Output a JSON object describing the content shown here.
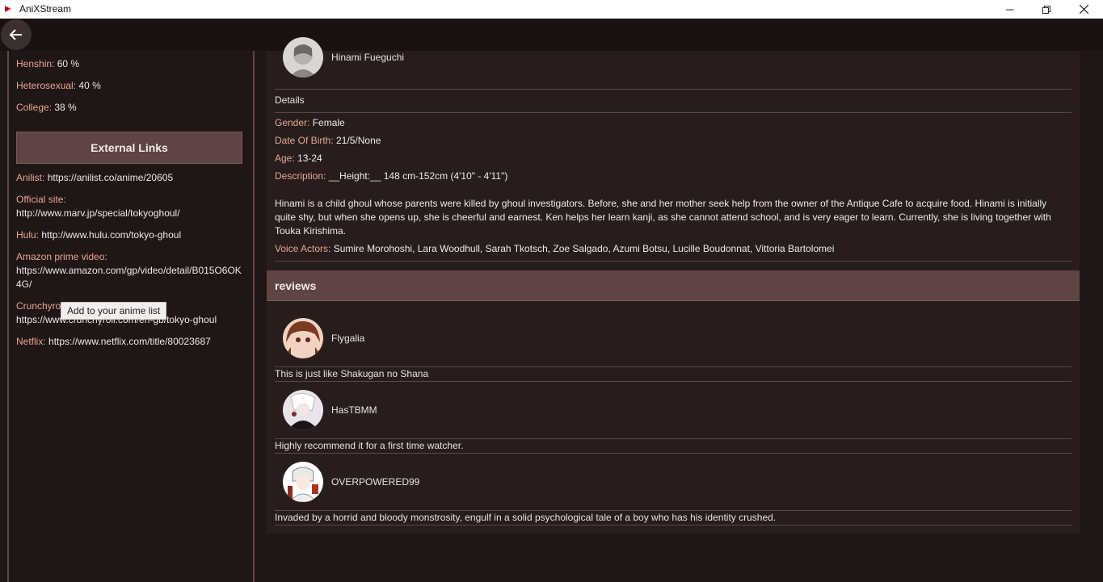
{
  "window": {
    "title": "AniXStream"
  },
  "sidebar": {
    "tags": [
      {
        "label": "Henshin:",
        "value": "60 %"
      },
      {
        "label": "Heterosexual:",
        "value": "40 %"
      },
      {
        "label": "College:",
        "value": "38 %"
      }
    ],
    "external_links_title": "External Links",
    "links": [
      {
        "label": "Anilist:",
        "url": "https://anilist.co/anime/20605"
      },
      {
        "label": "Official site:",
        "url": "http://www.marv.jp/special/tokyoghoul/"
      },
      {
        "label": "Hulu:",
        "url": "http://www.hulu.com/tokyo-ghoul"
      },
      {
        "label": "Amazon prime video:",
        "url": "https://www.amazon.com/gp/video/detail/B015O6OK4G/"
      },
      {
        "label": "Crunchyroll:",
        "url": "https://www.crunchyroll.com/en-gb/tokyo-ghoul"
      },
      {
        "label": "Netflix:",
        "url": "https://www.netflix.com/title/80023687"
      }
    ],
    "tooltip": "Add to your anime list"
  },
  "character": {
    "name": "Hinami Fueguchi",
    "details_title": "Details",
    "gender_label": "Gender:",
    "gender": "Female",
    "dob_label": "Date Of Birth:",
    "dob": "21/5/None",
    "age_label": "Age:",
    "age": "13-24",
    "description_label": "Description:",
    "description_short": "__Height:__ 148 cm-152cm (4'10\" - 4'11\")",
    "description_long": "Hinami is a child ghoul whose parents were killed by ghoul investigators. Before, she and her mother seek help from the owner of the Antique Cafe to acquire food. Hinami is initially quite shy, but when she opens up, she is cheerful and earnest. Ken helps her learn kanji, as she cannot attend school, and is very eager to learn. Currently, she is living together with Touka Kirishima.",
    "voice_actors_label": "Voice Actors:",
    "voice_actors": "Sumire Morohoshi, Lara Woodhull, Sarah Tkotsch, Zoe Salgado, Azumi Botsu, Lucille Boudonnat, Vittoria Bartolomei"
  },
  "reviews": {
    "title": "reviews",
    "items": [
      {
        "user": "Flygalia",
        "text": "This is just like Shakugan no Shana"
      },
      {
        "user": "HasTBMM",
        "text": "Highly recommend it for a first time watcher."
      },
      {
        "user": "OVERPOWERED99",
        "text": "Invaded by a horrid and bloody monstrosity, engulf in a solid psychological tale of a boy who has his identity crushed."
      }
    ]
  },
  "colors": {
    "accent": "#e8a58f",
    "header_bg": "#5e4444",
    "background": "#1f1616"
  }
}
